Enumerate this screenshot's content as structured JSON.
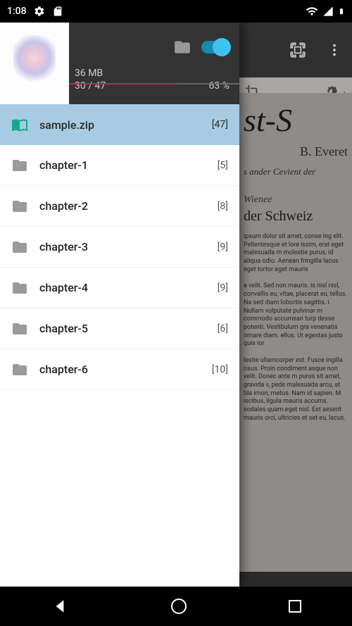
{
  "statusbar": {
    "time": "1:08"
  },
  "drawer": {
    "size": "36 MB",
    "progress": {
      "current": "30",
      "total": "47",
      "percent": "63 %",
      "fill_pct": 63
    },
    "items": [
      {
        "label": "sample.zip",
        "count": "[47]",
        "icon": "book",
        "active": true
      },
      {
        "label": "chapter-1",
        "count": "[5]",
        "icon": "folder",
        "active": false
      },
      {
        "label": "chapter-2",
        "count": "[8]",
        "icon": "folder",
        "active": false
      },
      {
        "label": "chapter-3",
        "count": "[9]",
        "icon": "folder",
        "active": false
      },
      {
        "label": "chapter-4",
        "count": "[9]",
        "icon": "folder",
        "active": false
      },
      {
        "label": "chapter-5",
        "count": "[6]",
        "icon": "folder",
        "active": false
      },
      {
        "label": "chapter-6",
        "count": "[10]",
        "icon": "folder",
        "active": false
      }
    ]
  },
  "document": {
    "title_fragment": "st-S",
    "author": "B. Everet",
    "subtitle_line": "s ander Cevient der",
    "section_sub": "Wienee",
    "section_heading": "der Schweiz",
    "body1": "ipsum dolor sit amet, conse ing elit. Pellentesque et lore issim, erat eget malesuada m molestie purus, id aliqua odio. Aenean fringilla lacus eget tortor eget mauris",
    "body2": "a velit. Sed non mauris. is nisl nisl, convallis eu, vitae, placerat eu, tellus. Na sed diam lobortis sagittis. i. Nullam vulputate pulvinar m commodo accumsan turp desse potenti. Vestibulum gra venenatis ornare diam. ellus. Ut egestas justo quis ior",
    "body3": "lestie ullamcorper est. Fusce ingilla risus. Proin condiment asque non velit. Donec ante m purus sit amet, gravida v, pede malesuada arcu, at bla imon, metus. Nam id sapien. M iscibus, ligula mauris accums. sodales quam eget nisl. Est aesent mauris orci, ultricies et set eu, lacus."
  }
}
